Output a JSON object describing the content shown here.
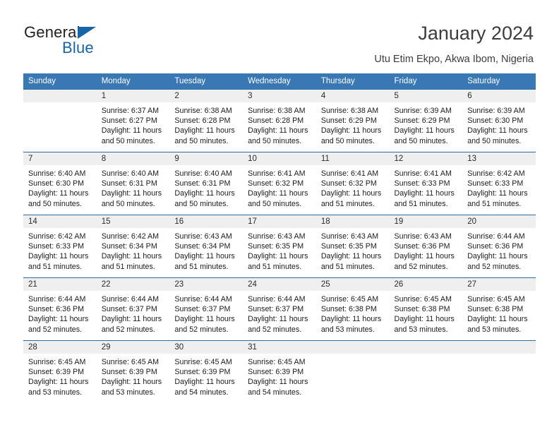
{
  "brand": {
    "name_part1": "General",
    "name_part2": "Blue",
    "accent_color": "#1565a8"
  },
  "header": {
    "title": "January 2024",
    "subtitle": "Utu Etim Ekpo, Akwa Ibom, Nigeria"
  },
  "theme": {
    "header_row_bg": "#3a78b5",
    "daynum_bg": "#efefef",
    "row_border": "#2e6ca8"
  },
  "weekday_headers": [
    "Sunday",
    "Monday",
    "Tuesday",
    "Wednesday",
    "Thursday",
    "Friday",
    "Saturday"
  ],
  "weeks": [
    [
      {
        "day": "",
        "sunrise": "",
        "sunset": "",
        "daylight_line1": "",
        "daylight_line2": "",
        "blank": true
      },
      {
        "day": "1",
        "sunrise": "Sunrise: 6:37 AM",
        "sunset": "Sunset: 6:27 PM",
        "daylight_line1": "Daylight: 11 hours",
        "daylight_line2": "and 50 minutes."
      },
      {
        "day": "2",
        "sunrise": "Sunrise: 6:38 AM",
        "sunset": "Sunset: 6:28 PM",
        "daylight_line1": "Daylight: 11 hours",
        "daylight_line2": "and 50 minutes."
      },
      {
        "day": "3",
        "sunrise": "Sunrise: 6:38 AM",
        "sunset": "Sunset: 6:28 PM",
        "daylight_line1": "Daylight: 11 hours",
        "daylight_line2": "and 50 minutes."
      },
      {
        "day": "4",
        "sunrise": "Sunrise: 6:38 AM",
        "sunset": "Sunset: 6:29 PM",
        "daylight_line1": "Daylight: 11 hours",
        "daylight_line2": "and 50 minutes."
      },
      {
        "day": "5",
        "sunrise": "Sunrise: 6:39 AM",
        "sunset": "Sunset: 6:29 PM",
        "daylight_line1": "Daylight: 11 hours",
        "daylight_line2": "and 50 minutes."
      },
      {
        "day": "6",
        "sunrise": "Sunrise: 6:39 AM",
        "sunset": "Sunset: 6:30 PM",
        "daylight_line1": "Daylight: 11 hours",
        "daylight_line2": "and 50 minutes."
      }
    ],
    [
      {
        "day": "7",
        "sunrise": "Sunrise: 6:40 AM",
        "sunset": "Sunset: 6:30 PM",
        "daylight_line1": "Daylight: 11 hours",
        "daylight_line2": "and 50 minutes."
      },
      {
        "day": "8",
        "sunrise": "Sunrise: 6:40 AM",
        "sunset": "Sunset: 6:31 PM",
        "daylight_line1": "Daylight: 11 hours",
        "daylight_line2": "and 50 minutes."
      },
      {
        "day": "9",
        "sunrise": "Sunrise: 6:40 AM",
        "sunset": "Sunset: 6:31 PM",
        "daylight_line1": "Daylight: 11 hours",
        "daylight_line2": "and 50 minutes."
      },
      {
        "day": "10",
        "sunrise": "Sunrise: 6:41 AM",
        "sunset": "Sunset: 6:32 PM",
        "daylight_line1": "Daylight: 11 hours",
        "daylight_line2": "and 50 minutes."
      },
      {
        "day": "11",
        "sunrise": "Sunrise: 6:41 AM",
        "sunset": "Sunset: 6:32 PM",
        "daylight_line1": "Daylight: 11 hours",
        "daylight_line2": "and 51 minutes."
      },
      {
        "day": "12",
        "sunrise": "Sunrise: 6:41 AM",
        "sunset": "Sunset: 6:33 PM",
        "daylight_line1": "Daylight: 11 hours",
        "daylight_line2": "and 51 minutes."
      },
      {
        "day": "13",
        "sunrise": "Sunrise: 6:42 AM",
        "sunset": "Sunset: 6:33 PM",
        "daylight_line1": "Daylight: 11 hours",
        "daylight_line2": "and 51 minutes."
      }
    ],
    [
      {
        "day": "14",
        "sunrise": "Sunrise: 6:42 AM",
        "sunset": "Sunset: 6:33 PM",
        "daylight_line1": "Daylight: 11 hours",
        "daylight_line2": "and 51 minutes."
      },
      {
        "day": "15",
        "sunrise": "Sunrise: 6:42 AM",
        "sunset": "Sunset: 6:34 PM",
        "daylight_line1": "Daylight: 11 hours",
        "daylight_line2": "and 51 minutes."
      },
      {
        "day": "16",
        "sunrise": "Sunrise: 6:43 AM",
        "sunset": "Sunset: 6:34 PM",
        "daylight_line1": "Daylight: 11 hours",
        "daylight_line2": "and 51 minutes."
      },
      {
        "day": "17",
        "sunrise": "Sunrise: 6:43 AM",
        "sunset": "Sunset: 6:35 PM",
        "daylight_line1": "Daylight: 11 hours",
        "daylight_line2": "and 51 minutes."
      },
      {
        "day": "18",
        "sunrise": "Sunrise: 6:43 AM",
        "sunset": "Sunset: 6:35 PM",
        "daylight_line1": "Daylight: 11 hours",
        "daylight_line2": "and 51 minutes."
      },
      {
        "day": "19",
        "sunrise": "Sunrise: 6:43 AM",
        "sunset": "Sunset: 6:36 PM",
        "daylight_line1": "Daylight: 11 hours",
        "daylight_line2": "and 52 minutes."
      },
      {
        "day": "20",
        "sunrise": "Sunrise: 6:44 AM",
        "sunset": "Sunset: 6:36 PM",
        "daylight_line1": "Daylight: 11 hours",
        "daylight_line2": "and 52 minutes."
      }
    ],
    [
      {
        "day": "21",
        "sunrise": "Sunrise: 6:44 AM",
        "sunset": "Sunset: 6:36 PM",
        "daylight_line1": "Daylight: 11 hours",
        "daylight_line2": "and 52 minutes."
      },
      {
        "day": "22",
        "sunrise": "Sunrise: 6:44 AM",
        "sunset": "Sunset: 6:37 PM",
        "daylight_line1": "Daylight: 11 hours",
        "daylight_line2": "and 52 minutes."
      },
      {
        "day": "23",
        "sunrise": "Sunrise: 6:44 AM",
        "sunset": "Sunset: 6:37 PM",
        "daylight_line1": "Daylight: 11 hours",
        "daylight_line2": "and 52 minutes."
      },
      {
        "day": "24",
        "sunrise": "Sunrise: 6:44 AM",
        "sunset": "Sunset: 6:37 PM",
        "daylight_line1": "Daylight: 11 hours",
        "daylight_line2": "and 52 minutes."
      },
      {
        "day": "25",
        "sunrise": "Sunrise: 6:45 AM",
        "sunset": "Sunset: 6:38 PM",
        "daylight_line1": "Daylight: 11 hours",
        "daylight_line2": "and 53 minutes."
      },
      {
        "day": "26",
        "sunrise": "Sunrise: 6:45 AM",
        "sunset": "Sunset: 6:38 PM",
        "daylight_line1": "Daylight: 11 hours",
        "daylight_line2": "and 53 minutes."
      },
      {
        "day": "27",
        "sunrise": "Sunrise: 6:45 AM",
        "sunset": "Sunset: 6:38 PM",
        "daylight_line1": "Daylight: 11 hours",
        "daylight_line2": "and 53 minutes."
      }
    ],
    [
      {
        "day": "28",
        "sunrise": "Sunrise: 6:45 AM",
        "sunset": "Sunset: 6:39 PM",
        "daylight_line1": "Daylight: 11 hours",
        "daylight_line2": "and 53 minutes."
      },
      {
        "day": "29",
        "sunrise": "Sunrise: 6:45 AM",
        "sunset": "Sunset: 6:39 PM",
        "daylight_line1": "Daylight: 11 hours",
        "daylight_line2": "and 53 minutes."
      },
      {
        "day": "30",
        "sunrise": "Sunrise: 6:45 AM",
        "sunset": "Sunset: 6:39 PM",
        "daylight_line1": "Daylight: 11 hours",
        "daylight_line2": "and 54 minutes."
      },
      {
        "day": "31",
        "sunrise": "Sunrise: 6:45 AM",
        "sunset": "Sunset: 6:39 PM",
        "daylight_line1": "Daylight: 11 hours",
        "daylight_line2": "and 54 minutes."
      },
      {
        "day": "",
        "sunrise": "",
        "sunset": "",
        "daylight_line1": "",
        "daylight_line2": "",
        "blank": true
      },
      {
        "day": "",
        "sunrise": "",
        "sunset": "",
        "daylight_line1": "",
        "daylight_line2": "",
        "blank": true
      },
      {
        "day": "",
        "sunrise": "",
        "sunset": "",
        "daylight_line1": "",
        "daylight_line2": "",
        "blank": true
      }
    ]
  ]
}
